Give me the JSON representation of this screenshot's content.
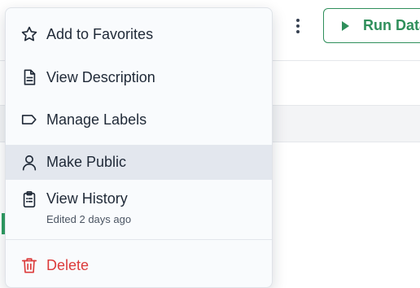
{
  "toolbar": {
    "more_icon": "kebab-vertical-icon",
    "run_button_label": "Run Data",
    "run_button_icon": "play-icon",
    "accent_color": "#2f8f5b"
  },
  "menu": {
    "items": [
      {
        "label": "Add to Favorites",
        "icon": "star-outline-icon"
      },
      {
        "label": "View Description",
        "icon": "document-icon"
      },
      {
        "label": "Manage Labels",
        "icon": "tag-icon"
      },
      {
        "label": "Make Public",
        "icon": "user-icon",
        "highlighted": true
      },
      {
        "label": "View History",
        "icon": "clipboard-list-icon",
        "sublabel": "Edited 2 days ago"
      },
      {
        "label": "Delete",
        "icon": "trash-icon",
        "color": "#dc3b3b"
      }
    ]
  }
}
